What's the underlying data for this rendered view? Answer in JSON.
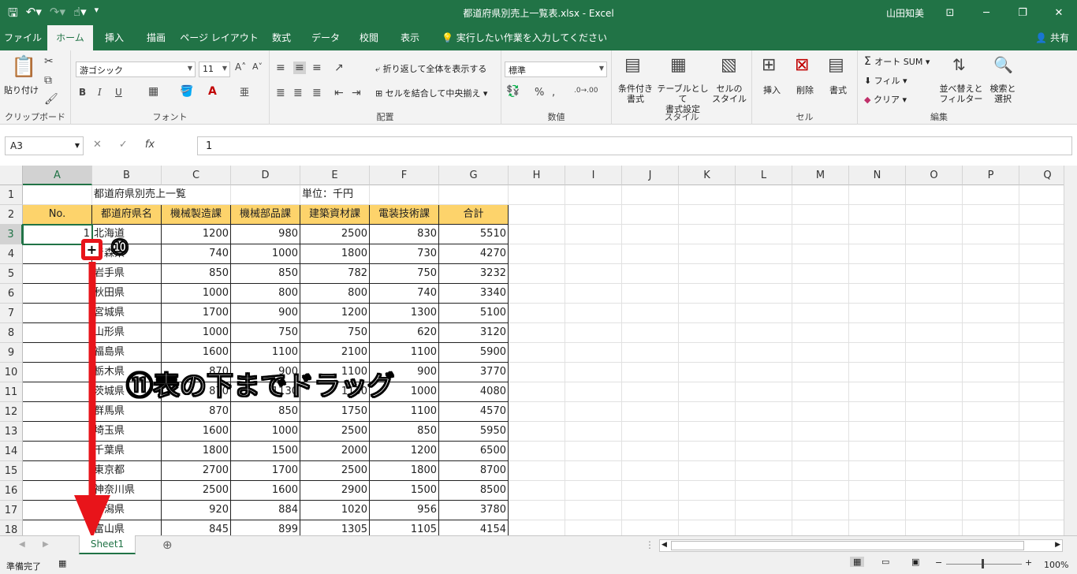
{
  "titlebar": {
    "title": "都道府県別売上一覧表.xlsx  -  Excel",
    "user": "山田知美",
    "qat_icons": [
      "save-icon",
      "undo-icon",
      "redo-icon",
      "touch-mode-icon",
      "customize-icon"
    ]
  },
  "tabs": [
    "ファイル",
    "ホーム",
    "挿入",
    "描画",
    "ページ レイアウト",
    "数式",
    "データ",
    "校閲",
    "表示"
  ],
  "active_tab": "ホーム",
  "tell_me": "実行したい作業を入力してください",
  "share": "共有",
  "ribbon": {
    "clipboard": {
      "label": "クリップボード",
      "paste": "貼り付け"
    },
    "font": {
      "label": "フォント",
      "name": "游ゴシック",
      "size": "11",
      "bold": "B",
      "italic": "I",
      "underline": "U"
    },
    "alignment": {
      "label": "配置",
      "wrap": "折り返して全体を表示する",
      "merge": "セルを結合して中央揃え"
    },
    "number": {
      "label": "数値",
      "format": "標準",
      "percent": "%",
      "comma": ","
    },
    "styles": {
      "label": "スタイル",
      "conditional": "条件付き\n書式",
      "table": "テーブルとして\n書式設定",
      "cell": "セルの\nスタイル"
    },
    "cells": {
      "label": "セル",
      "insert": "挿入",
      "delete": "削除",
      "format": "書式"
    },
    "editing": {
      "label": "編集",
      "autosum": "オート SUM",
      "fill": "フィル",
      "clear": "クリア",
      "sort": "並べ替えと\nフィルター",
      "find": "検索と\n選択"
    }
  },
  "formula_bar": {
    "name_box": "A3",
    "formula": "1"
  },
  "columns": [
    "A",
    "B",
    "C",
    "D",
    "E",
    "F",
    "G",
    "H",
    "I",
    "J",
    "K",
    "L",
    "M",
    "N",
    "O",
    "P",
    "Q"
  ],
  "rows": [
    "1",
    "2",
    "3",
    "4",
    "5",
    "6",
    "7",
    "8",
    "9",
    "10",
    "11",
    "12",
    "13",
    "14",
    "15",
    "16",
    "17",
    "18"
  ],
  "sheet": {
    "b1": "都道府県別売上一覧",
    "e1": "単位：千円",
    "headers": [
      "No.",
      "都道府県名",
      "機械製造課",
      "機械部品課",
      "建築資材課",
      "電装技術課",
      "合計"
    ],
    "a3": "1",
    "data": [
      [
        "北海道",
        "1200",
        "980",
        "2500",
        "830",
        "5510"
      ],
      [
        "青森県",
        "740",
        "1000",
        "1800",
        "730",
        "4270"
      ],
      [
        "岩手県",
        "850",
        "850",
        "782",
        "750",
        "3232"
      ],
      [
        "秋田県",
        "1000",
        "800",
        "800",
        "740",
        "3340"
      ],
      [
        "宮城県",
        "1700",
        "900",
        "1200",
        "1300",
        "5100"
      ],
      [
        "山形県",
        "1000",
        "750",
        "750",
        "620",
        "3120"
      ],
      [
        "福島県",
        "1600",
        "1100",
        "2100",
        "1100",
        "5900"
      ],
      [
        "栃木県",
        "870",
        "900",
        "1100",
        "900",
        "3770"
      ],
      [
        "茨城県",
        "870",
        "1130",
        "1130",
        "1000",
        "4080"
      ],
      [
        "群馬県",
        "870",
        "850",
        "1750",
        "1100",
        "4570"
      ],
      [
        "埼玉県",
        "1600",
        "1000",
        "2500",
        "850",
        "5950"
      ],
      [
        "千葉県",
        "1800",
        "1500",
        "2000",
        "1200",
        "6500"
      ],
      [
        "東京都",
        "2700",
        "1700",
        "2500",
        "1800",
        "8700"
      ],
      [
        "神奈川県",
        "2500",
        "1600",
        "2900",
        "1500",
        "8500"
      ],
      [
        "新潟県",
        "920",
        "884",
        "1020",
        "956",
        "3780"
      ],
      [
        "富山県",
        "845",
        "899",
        "1305",
        "1105",
        "4154"
      ]
    ]
  },
  "annotations": {
    "step10": "⑩",
    "step11": "⑪表の下までドラッグ",
    "arrow_color": "#e8141a"
  },
  "sheet_tab": "Sheet1",
  "status": {
    "ready": "準備完了",
    "zoom": "100%"
  },
  "colors": {
    "excel_green": "#217346",
    "header_fill": "#fdd36b"
  }
}
